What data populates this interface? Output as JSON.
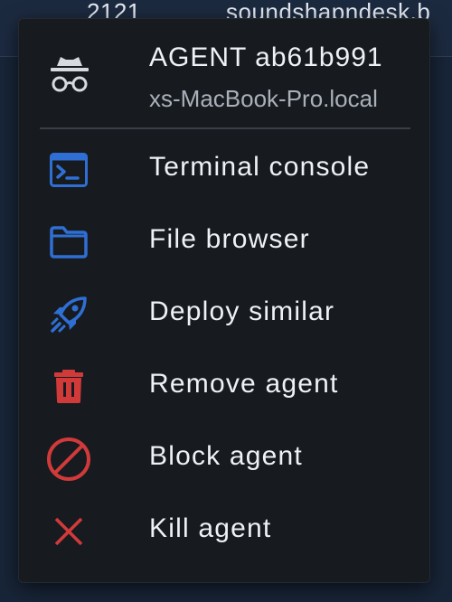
{
  "background": {
    "left_text": "2121",
    "right_text": "soundshapndesk.b"
  },
  "menu": {
    "header": {
      "icon": "incognito-icon",
      "title": "AGENT ab61b991",
      "host": "xs-MacBook-Pro.local"
    },
    "items": [
      {
        "label": "Terminal console",
        "icon": "terminal-icon",
        "color": "#2f6fd4"
      },
      {
        "label": "File browser",
        "icon": "folder-icon",
        "color": "#2f6fd4"
      },
      {
        "label": "Deploy similar",
        "icon": "rocket-icon",
        "color": "#2f6fd4"
      },
      {
        "label": "Remove agent",
        "icon": "trash-icon",
        "color": "#d23a3a"
      },
      {
        "label": "Block agent",
        "icon": "ban-icon",
        "color": "#d23a3a"
      },
      {
        "label": "Kill agent",
        "icon": "close-icon",
        "color": "#d23a3a"
      }
    ]
  }
}
